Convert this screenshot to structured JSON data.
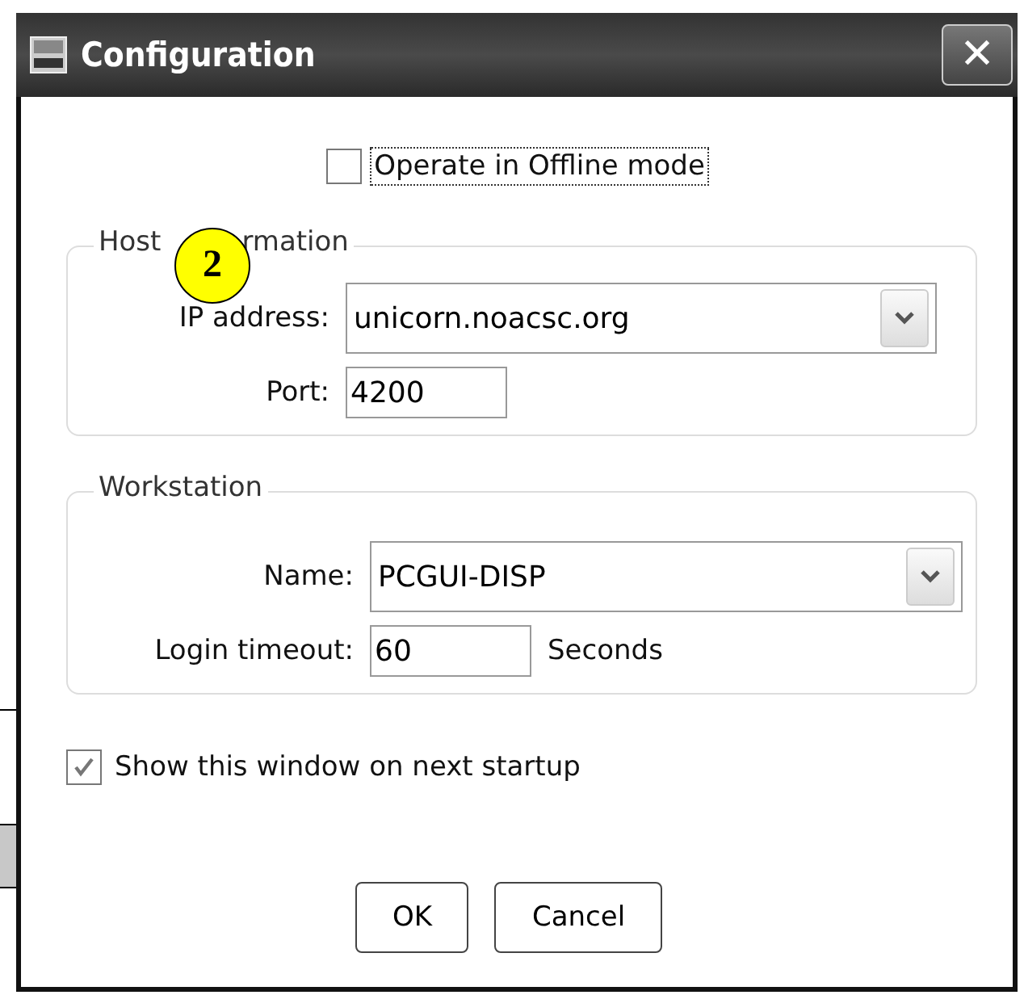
{
  "window": {
    "title": "Configuration",
    "close": "✕"
  },
  "offline": {
    "label": "Operate in Offline mode",
    "checked": false
  },
  "host_group": {
    "legend_parts": [
      "Host",
      "rmation"
    ],
    "fields": [
      {
        "kind": "combo",
        "label": "IP address:",
        "value": "unicorn.noacsc.org"
      },
      {
        "kind": "text",
        "label": "Port:",
        "value": "4200"
      }
    ]
  },
  "callout": "2",
  "workstation_group": {
    "legend": "Workstation",
    "fields": [
      {
        "kind": "combo",
        "label": "Name:",
        "value": "PCGUI-DISP"
      },
      {
        "kind": "text",
        "label": "Login timeout:",
        "value": "60",
        "unit": "Seconds"
      }
    ]
  },
  "show_on_startup": {
    "label": "Show this window on next startup",
    "checked": true
  },
  "buttons": [
    "OK",
    "Cancel"
  ]
}
